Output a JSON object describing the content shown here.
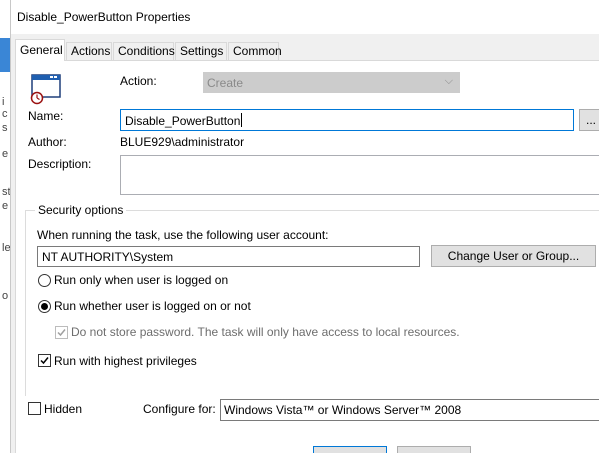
{
  "window": {
    "title": "Disable_PowerButton Properties"
  },
  "tabs": [
    {
      "label": "General",
      "active": true
    },
    {
      "label": "Actions"
    },
    {
      "label": "Conditions"
    },
    {
      "label": "Settings"
    },
    {
      "label": "Common"
    }
  ],
  "general": {
    "action_label": "Action:",
    "action_value": "Create",
    "name_label": "Name:",
    "name_value": "Disable_PowerButton",
    "name_browse_label": "...",
    "author_label": "Author:",
    "author_value": "BLUE929\\administrator",
    "description_label": "Description:",
    "description_value": ""
  },
  "security": {
    "group_title": "Security options",
    "account_prompt": "When running the task, use the following user account:",
    "account_value": "NT AUTHORITY\\System",
    "change_user_label": "Change User or Group...",
    "radio_logged_on": "Run only when user is logged on",
    "radio_whether": "Run whether user is logged on or not",
    "radio_selected": "whether",
    "no_store_password": "Do not store password.  The task will only have access to local resources.",
    "no_store_password_checked": true,
    "highest_privileges": "Run with highest privileges",
    "highest_privileges_checked": true
  },
  "footer": {
    "hidden_label": "Hidden",
    "hidden_checked": false,
    "configure_label": "Configure for:",
    "configure_value": "Windows Vista™ or Windows Server™ 2008"
  },
  "background": {
    "chars": [
      "i",
      "c",
      "s",
      "e",
      "st",
      "e",
      "le",
      "o"
    ]
  },
  "colors": {
    "accent": "#0078d7",
    "panel": "#ffffff",
    "chrome": "#f0f0f0"
  }
}
